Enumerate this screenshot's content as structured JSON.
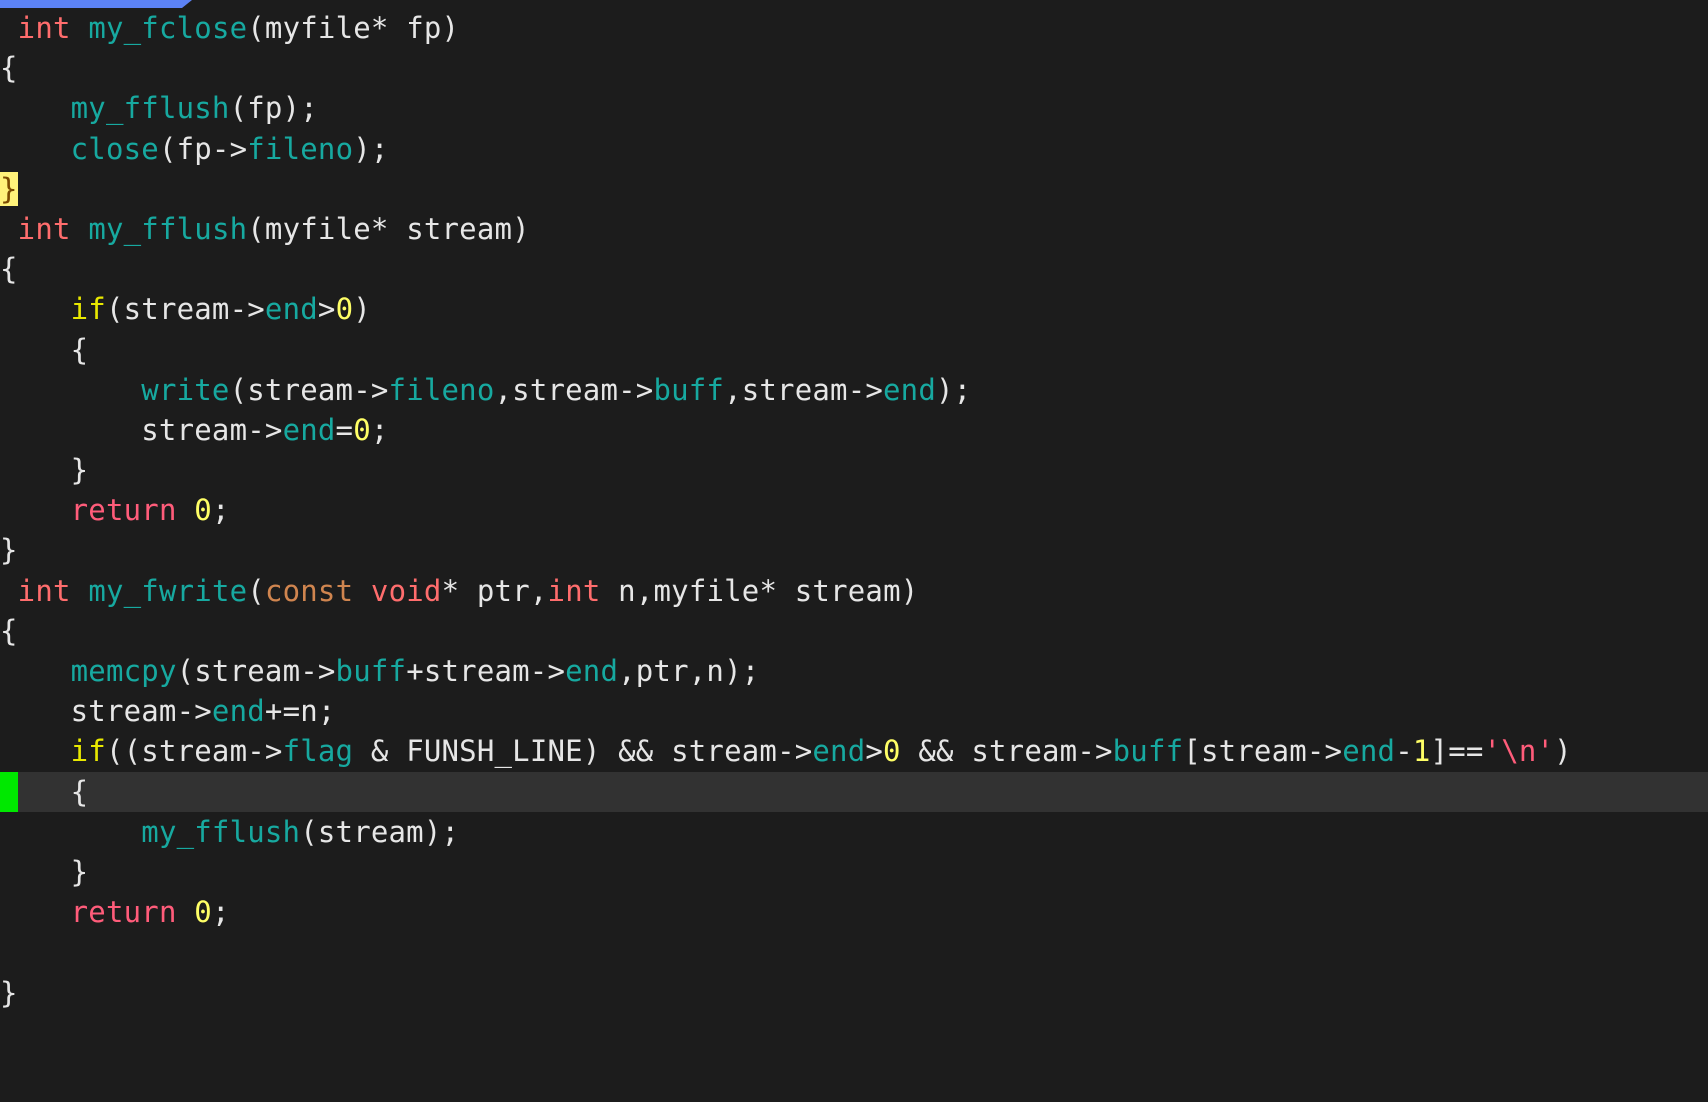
{
  "app": {
    "kind": "code-editor",
    "language": "c",
    "background": "#1c1c1c",
    "topbar_color": "#5c82f5"
  },
  "palette": {
    "background": "#1c1c1c",
    "foreground": "#e6e6e6",
    "type_keyword": "#ff6d6d",
    "storage_keyword": "#d0854f",
    "function": "#17a9a0",
    "member": "#17a9a0",
    "conditional": "#e8e800",
    "return_keyword": "#ff5c7a",
    "number": "#ffff66",
    "string": "#ff5c7a",
    "matchparen_bg": "#fff27a",
    "matchparen_fg": "#7a4a00",
    "cursorline_bg": "#323232",
    "signcolumn_marker": "#00e800"
  },
  "lines": [
    {
      "id": 1,
      "cursorline": false,
      "sign": false,
      "tokens": [
        {
          "text": " ",
          "cls": "t-punct"
        },
        {
          "text": "int",
          "cls": "t-type"
        },
        {
          "text": " ",
          "cls": "t-punct"
        },
        {
          "text": "my_fclose",
          "cls": "t-func"
        },
        {
          "text": "(myfile* fp)",
          "cls": "t-punct"
        }
      ]
    },
    {
      "id": 2,
      "cursorline": false,
      "sign": false,
      "tokens": [
        {
          "text": "{",
          "cls": "t-punct"
        }
      ]
    },
    {
      "id": 3,
      "cursorline": false,
      "sign": false,
      "tokens": [
        {
          "text": "    ",
          "cls": "t-punct"
        },
        {
          "text": "my_fflush",
          "cls": "t-func"
        },
        {
          "text": "(fp);",
          "cls": "t-punct"
        }
      ]
    },
    {
      "id": 4,
      "cursorline": false,
      "sign": false,
      "tokens": [
        {
          "text": "    ",
          "cls": "t-punct"
        },
        {
          "text": "close",
          "cls": "t-func"
        },
        {
          "text": "(fp->",
          "cls": "t-punct"
        },
        {
          "text": "fileno",
          "cls": "t-member"
        },
        {
          "text": ");",
          "cls": "t-punct"
        }
      ]
    },
    {
      "id": 5,
      "cursorline": false,
      "sign": false,
      "tokens": [
        {
          "text": "}",
          "cls": "matchparen"
        }
      ]
    },
    {
      "id": 6,
      "cursorline": false,
      "sign": false,
      "tokens": [
        {
          "text": " ",
          "cls": "t-punct"
        },
        {
          "text": "int",
          "cls": "t-type"
        },
        {
          "text": " ",
          "cls": "t-punct"
        },
        {
          "text": "my_fflush",
          "cls": "t-func"
        },
        {
          "text": "(myfile* stream)",
          "cls": "t-punct"
        }
      ]
    },
    {
      "id": 7,
      "cursorline": false,
      "sign": false,
      "tokens": [
        {
          "text": "{",
          "cls": "t-punct"
        }
      ]
    },
    {
      "id": 8,
      "cursorline": false,
      "sign": false,
      "tokens": [
        {
          "text": "    ",
          "cls": "t-punct"
        },
        {
          "text": "if",
          "cls": "t-cond"
        },
        {
          "text": "(stream->",
          "cls": "t-punct"
        },
        {
          "text": "end",
          "cls": "t-member"
        },
        {
          "text": ">",
          "cls": "t-punct"
        },
        {
          "text": "0",
          "cls": "t-num"
        },
        {
          "text": ")",
          "cls": "t-punct"
        }
      ]
    },
    {
      "id": 9,
      "cursorline": false,
      "sign": false,
      "tokens": [
        {
          "text": "    {",
          "cls": "t-punct"
        }
      ]
    },
    {
      "id": 10,
      "cursorline": false,
      "sign": false,
      "tokens": [
        {
          "text": "        ",
          "cls": "t-punct"
        },
        {
          "text": "write",
          "cls": "t-func"
        },
        {
          "text": "(stream->",
          "cls": "t-punct"
        },
        {
          "text": "fileno",
          "cls": "t-member"
        },
        {
          "text": ",stream->",
          "cls": "t-punct"
        },
        {
          "text": "buff",
          "cls": "t-member"
        },
        {
          "text": ",stream->",
          "cls": "t-punct"
        },
        {
          "text": "end",
          "cls": "t-member"
        },
        {
          "text": ");",
          "cls": "t-punct"
        }
      ]
    },
    {
      "id": 11,
      "cursorline": false,
      "sign": false,
      "tokens": [
        {
          "text": "        stream->",
          "cls": "t-punct"
        },
        {
          "text": "end",
          "cls": "t-member"
        },
        {
          "text": "=",
          "cls": "t-punct"
        },
        {
          "text": "0",
          "cls": "t-num"
        },
        {
          "text": ";",
          "cls": "t-punct"
        }
      ]
    },
    {
      "id": 12,
      "cursorline": false,
      "sign": false,
      "tokens": [
        {
          "text": "    }",
          "cls": "t-punct"
        }
      ]
    },
    {
      "id": 13,
      "cursorline": false,
      "sign": false,
      "tokens": [
        {
          "text": "    ",
          "cls": "t-punct"
        },
        {
          "text": "return",
          "cls": "t-return"
        },
        {
          "text": " ",
          "cls": "t-punct"
        },
        {
          "text": "0",
          "cls": "t-num"
        },
        {
          "text": ";",
          "cls": "t-punct"
        }
      ]
    },
    {
      "id": 14,
      "cursorline": false,
      "sign": false,
      "tokens": [
        {
          "text": "}",
          "cls": "t-punct"
        }
      ]
    },
    {
      "id": 15,
      "cursorline": false,
      "sign": false,
      "tokens": [
        {
          "text": " ",
          "cls": "t-punct"
        },
        {
          "text": "int",
          "cls": "t-type"
        },
        {
          "text": " ",
          "cls": "t-punct"
        },
        {
          "text": "my_fwrite",
          "cls": "t-func"
        },
        {
          "text": "(",
          "cls": "t-punct"
        },
        {
          "text": "const",
          "cls": "t-storage"
        },
        {
          "text": " ",
          "cls": "t-punct"
        },
        {
          "text": "void",
          "cls": "t-type"
        },
        {
          "text": "* ptr,",
          "cls": "t-punct"
        },
        {
          "text": "int",
          "cls": "t-type"
        },
        {
          "text": " n,myfile* stream)",
          "cls": "t-punct"
        }
      ]
    },
    {
      "id": 16,
      "cursorline": false,
      "sign": false,
      "tokens": [
        {
          "text": "{",
          "cls": "t-punct"
        }
      ]
    },
    {
      "id": 17,
      "cursorline": false,
      "sign": false,
      "tokens": [
        {
          "text": "    ",
          "cls": "t-punct"
        },
        {
          "text": "memcpy",
          "cls": "t-func"
        },
        {
          "text": "(stream->",
          "cls": "t-punct"
        },
        {
          "text": "buff",
          "cls": "t-member"
        },
        {
          "text": "+stream->",
          "cls": "t-punct"
        },
        {
          "text": "end",
          "cls": "t-member"
        },
        {
          "text": ",ptr,n);",
          "cls": "t-punct"
        }
      ]
    },
    {
      "id": 18,
      "cursorline": false,
      "sign": false,
      "tokens": [
        {
          "text": "    stream->",
          "cls": "t-punct"
        },
        {
          "text": "end",
          "cls": "t-member"
        },
        {
          "text": "+=n;",
          "cls": "t-punct"
        }
      ]
    },
    {
      "id": 19,
      "cursorline": false,
      "sign": false,
      "tokens": [
        {
          "text": "    ",
          "cls": "t-punct"
        },
        {
          "text": "if",
          "cls": "t-cond"
        },
        {
          "text": "((stream->",
          "cls": "t-punct"
        },
        {
          "text": "flag",
          "cls": "t-member"
        },
        {
          "text": " & ",
          "cls": "t-punct"
        },
        {
          "text": "FUNSH_LINE",
          "cls": "t-const-id"
        },
        {
          "text": ") && stream->",
          "cls": "t-punct"
        },
        {
          "text": "end",
          "cls": "t-member"
        },
        {
          "text": ">",
          "cls": "t-punct"
        },
        {
          "text": "0",
          "cls": "t-num"
        },
        {
          "text": " && stream->",
          "cls": "t-punct"
        },
        {
          "text": "buff",
          "cls": "t-member"
        },
        {
          "text": "[stream->",
          "cls": "t-punct"
        },
        {
          "text": "end",
          "cls": "t-member"
        },
        {
          "text": "-",
          "cls": "t-punct"
        },
        {
          "text": "1",
          "cls": "t-num"
        },
        {
          "text": "]==",
          "cls": "t-punct"
        },
        {
          "text": "'\\n'",
          "cls": "t-string"
        },
        {
          "text": ")",
          "cls": "t-punct"
        }
      ]
    },
    {
      "id": 20,
      "cursorline": true,
      "sign": true,
      "tokens": [
        {
          "text": "    {",
          "cls": "t-punct"
        }
      ]
    },
    {
      "id": 21,
      "cursorline": false,
      "sign": false,
      "tokens": [
        {
          "text": "        ",
          "cls": "t-punct"
        },
        {
          "text": "my_fflush",
          "cls": "t-func"
        },
        {
          "text": "(stream);",
          "cls": "t-punct"
        }
      ]
    },
    {
      "id": 22,
      "cursorline": false,
      "sign": false,
      "tokens": [
        {
          "text": "    }",
          "cls": "t-punct"
        }
      ]
    },
    {
      "id": 23,
      "cursorline": false,
      "sign": false,
      "tokens": [
        {
          "text": "    ",
          "cls": "t-punct"
        },
        {
          "text": "return",
          "cls": "t-return"
        },
        {
          "text": " ",
          "cls": "t-punct"
        },
        {
          "text": "0",
          "cls": "t-num"
        },
        {
          "text": ";",
          "cls": "t-punct"
        }
      ]
    },
    {
      "id": 24,
      "cursorline": false,
      "sign": false,
      "tokens": []
    },
    {
      "id": 25,
      "cursorline": false,
      "sign": false,
      "tokens": [
        {
          "text": "}",
          "cls": "t-punct"
        }
      ]
    }
  ]
}
